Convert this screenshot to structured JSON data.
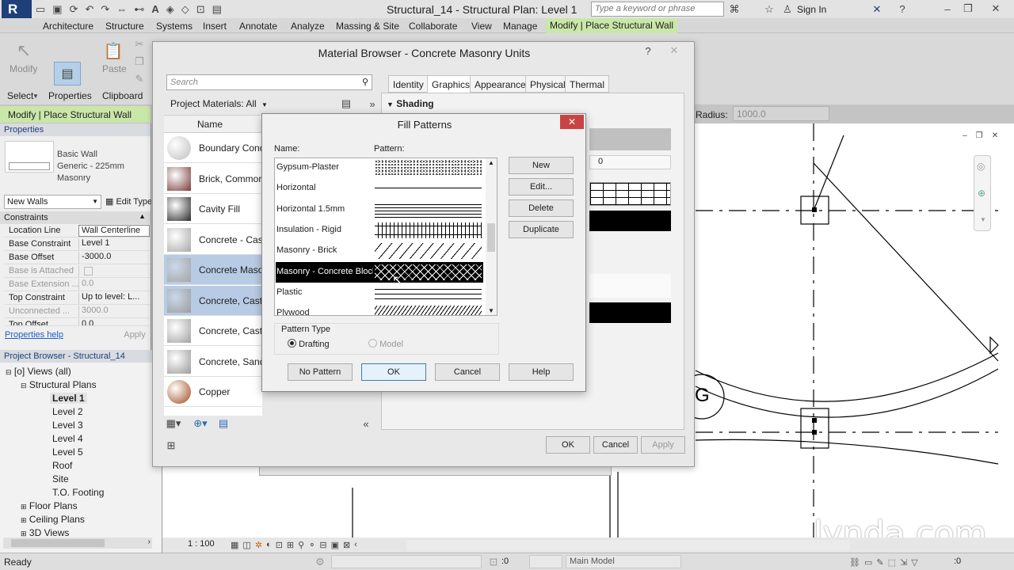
{
  "app": {
    "window_title": "Structural_14 - Structural Plan: Level 1",
    "search_placeholder": "Type a keyword or phrase",
    "sign_in": "Sign In"
  },
  "ribbon_tabs": [
    "Architecture",
    "Structure",
    "Systems",
    "Insert",
    "Annotate",
    "Analyze",
    "Massing & Site",
    "Collaborate",
    "View",
    "Manage",
    "Modify | Place Structural Wall"
  ],
  "ribbon": {
    "modify": "Modify",
    "paste": "Paste",
    "select": "Select",
    "properties": "Properties",
    "clipboard": "Clipboard"
  },
  "option_bar": {
    "context": "Modify | Place Structural Wall",
    "radius_label": "Radius:",
    "radius_value": "1000.0"
  },
  "properties": {
    "title": "Properties",
    "type_family": "Basic Wall",
    "type_name": "Generic - 225mm",
    "type_sub": "Masonry",
    "instance_selector": "New Walls",
    "edit_type": "Edit Type",
    "section": "Constraints",
    "rows": [
      {
        "k": "Location Line",
        "v": "Wall Centerline"
      },
      {
        "k": "Base Constraint",
        "v": "Level 1"
      },
      {
        "k": "Base Offset",
        "v": "-3000.0"
      },
      {
        "k": "Base is Attached",
        "v": ""
      },
      {
        "k": "Base Extension ...",
        "v": "0.0"
      },
      {
        "k": "Top Constraint",
        "v": "Up to level: L..."
      },
      {
        "k": "Unconnected ...",
        "v": "3000.0"
      },
      {
        "k": "Top Offset",
        "v": "0.0"
      }
    ],
    "help": "Properties help",
    "apply": "Apply"
  },
  "project_browser": {
    "title": "Project Browser - Structural_14",
    "views_all": "Views (all)",
    "structural_plans": "Structural Plans",
    "levels": [
      "Level 1",
      "Level 2",
      "Level 3",
      "Level 4",
      "Level 5",
      "Roof",
      "Site",
      "T.O. Footing"
    ],
    "floor_plans": "Floor Plans",
    "ceiling_plans": "Ceiling Plans",
    "views_3d": "3D Views"
  },
  "material_browser": {
    "title": "Material Browser - Concrete Masonry Units",
    "search_placeholder": "Search",
    "filter": "Project Materials: All",
    "name_header": "Name",
    "materials": [
      {
        "name": "Boundary Conditions",
        "color": "#bdbdbd"
      },
      {
        "name": "Brick, Common",
        "color": "#7a3a3a"
      },
      {
        "name": "Cavity Fill",
        "color": "#2a2a2a"
      },
      {
        "name": "Concrete - Cast-in-Place",
        "color": "#a8a8a8"
      },
      {
        "name": "Concrete Masonry Units",
        "color": "#a4a4a4"
      },
      {
        "name": "Concrete, Cast In Situ",
        "color": "#9c9c9c"
      },
      {
        "name": "Concrete, Cast-in-Place",
        "color": "#a0a0a0"
      },
      {
        "name": "Concrete, Sand/Cement",
        "color": "#9a9a9a"
      },
      {
        "name": "Copper",
        "color": "#a04a1e"
      }
    ],
    "tabs": [
      "Identity",
      "Graphics",
      "Appearance",
      "Physical",
      "Thermal"
    ],
    "active_tab": "Graphics",
    "section": "Shading",
    "field_value": "0",
    "ok": "OK",
    "cancel": "Cancel",
    "apply": "Apply"
  },
  "fill_patterns": {
    "title": "Fill Patterns",
    "name_label": "Name:",
    "pattern_label": "Pattern:",
    "patterns": [
      {
        "name": "Gypsum-Plaster",
        "kind": "dots"
      },
      {
        "name": "Horizontal",
        "kind": "hline"
      },
      {
        "name": "Horizontal 1.5mm",
        "kind": "hlines"
      },
      {
        "name": "Insulation - Rigid",
        "kind": "grid"
      },
      {
        "name": "Masonry - Brick",
        "kind": "diag"
      },
      {
        "name": "Masonry - Concrete Block",
        "kind": "cross"
      },
      {
        "name": "Plastic",
        "kind": "hlines2"
      },
      {
        "name": "Plywood",
        "kind": "zig"
      }
    ],
    "selected": "Masonry - Concrete Block",
    "buttons": {
      "new": "New",
      "edit": "Edit...",
      "delete": "Delete",
      "duplicate": "Duplicate"
    },
    "pattern_type": "Pattern Type",
    "drafting": "Drafting",
    "model": "Model",
    "no_pattern": "No Pattern",
    "ok": "OK",
    "cancel": "Cancel",
    "help": "Help"
  },
  "view_control": {
    "scale": "1 : 100"
  },
  "status": {
    "ready": "Ready",
    "zero": ":0",
    "model": "Main Model",
    "zero2": ":0"
  },
  "canvas": {
    "grid_label": "G"
  },
  "watermark": "lynda.com"
}
